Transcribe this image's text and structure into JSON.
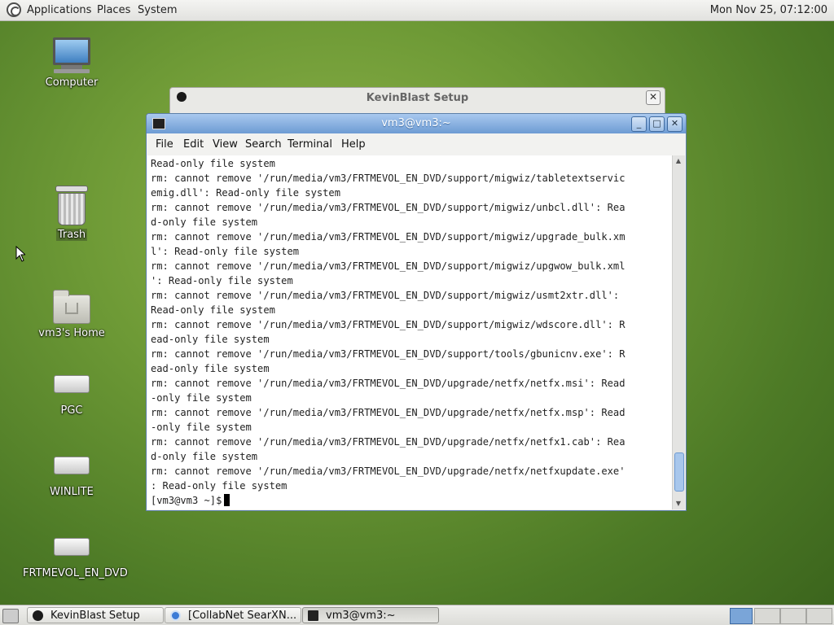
{
  "top_panel": {
    "menus": [
      "Applications",
      "Places",
      "System"
    ],
    "clock": "Mon Nov 25, 07:12:00"
  },
  "desktop": {
    "icons": [
      {
        "label": "Computer",
        "icon": "computer-icon"
      },
      {
        "label": "Trash",
        "icon": "trash-icon"
      },
      {
        "label": "vm3's Home",
        "icon": "home-folder-icon"
      },
      {
        "label": "PGC",
        "icon": "drive-icon"
      },
      {
        "label": "WINLITE",
        "icon": "drive-icon"
      },
      {
        "label": "FRTMEVOL_EN_DVD",
        "icon": "drive-icon"
      }
    ]
  },
  "background_dialog": {
    "title": "KevinBlast Setup",
    "close_glyph": "✕"
  },
  "terminal": {
    "title": "vm3@vm3:~",
    "buttons": {
      "minimize": "_",
      "maximize": "□",
      "close": "✕"
    },
    "menu": [
      "File",
      "Edit",
      "View",
      "Search",
      "Terminal",
      "Help"
    ],
    "lines": [
      "Read-only file system",
      "rm: cannot remove '/run/media/vm3/FRTMEVOL_EN_DVD/support/migwiz/tabletextservic",
      "emig.dll': Read-only file system",
      "rm: cannot remove '/run/media/vm3/FRTMEVOL_EN_DVD/support/migwiz/unbcl.dll': Rea",
      "d-only file system",
      "rm: cannot remove '/run/media/vm3/FRTMEVOL_EN_DVD/support/migwiz/upgrade_bulk.xm",
      "l': Read-only file system",
      "rm: cannot remove '/run/media/vm3/FRTMEVOL_EN_DVD/support/migwiz/upgwow_bulk.xml",
      "': Read-only file system",
      "rm: cannot remove '/run/media/vm3/FRTMEVOL_EN_DVD/support/migwiz/usmt2xtr.dll':",
      "Read-only file system",
      "rm: cannot remove '/run/media/vm3/FRTMEVOL_EN_DVD/support/migwiz/wdscore.dll': R",
      "ead-only file system",
      "rm: cannot remove '/run/media/vm3/FRTMEVOL_EN_DVD/support/tools/gbunicnv.exe': R",
      "ead-only file system",
      "rm: cannot remove '/run/media/vm3/FRTMEVOL_EN_DVD/upgrade/netfx/netfx.msi': Read",
      "-only file system",
      "rm: cannot remove '/run/media/vm3/FRTMEVOL_EN_DVD/upgrade/netfx/netfx.msp': Read",
      "-only file system",
      "rm: cannot remove '/run/media/vm3/FRTMEVOL_EN_DVD/upgrade/netfx/netfx1.cab': Rea",
      "d-only file system",
      "rm: cannot remove '/run/media/vm3/FRTMEVOL_EN_DVD/upgrade/netfx/netfxupdate.exe'",
      ": Read-only file system"
    ],
    "prompt": "[vm3@vm3 ~]$"
  },
  "taskbar": {
    "tasks": [
      {
        "label": "KevinBlast Setup",
        "icon": "app-icon"
      },
      {
        "label": "[CollabNet SearXN...",
        "icon": "browser-icon"
      },
      {
        "label": "vm3@vm3:~",
        "icon": "terminal-icon"
      }
    ]
  },
  "colors": {
    "titlebar_active": "#6d9bd3",
    "desktop_green": "#6e9a36"
  }
}
